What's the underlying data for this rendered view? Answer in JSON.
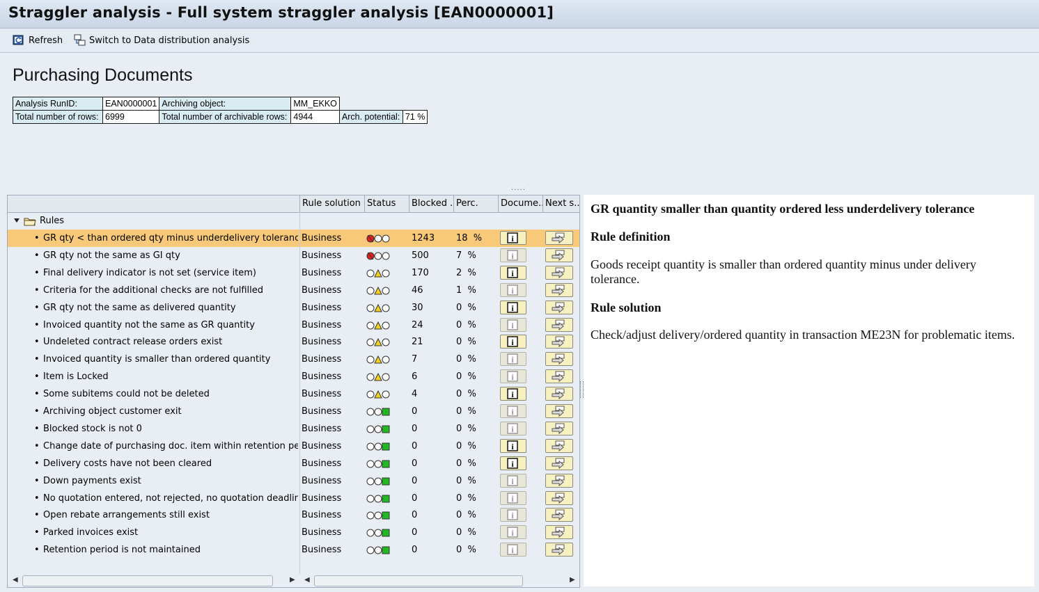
{
  "window": {
    "title": "Straggler analysis - Full system straggler analysis [EAN0000001]"
  },
  "toolbar": {
    "refresh_label": "Refresh",
    "switch_label": "Switch to Data distribution analysis"
  },
  "page": {
    "heading": "Purchasing Documents"
  },
  "info": {
    "run_id_label": "Analysis RunID:",
    "run_id": "EAN0000001",
    "arch_obj_label": "Archiving object:",
    "arch_obj": "MM_EKKO",
    "total_rows_label": "Total number of rows:",
    "total_rows": "6999",
    "archivable_label": "Total number of archivable rows:",
    "archivable": "4944",
    "potential_label": "Arch. potential:",
    "potential": "71 %"
  },
  "grid": {
    "columns": [
      "Rule solution",
      "Status",
      "Blocked ...",
      "Perc.",
      "Docume...",
      "Next s..."
    ],
    "root_label": "Rules",
    "rows": [
      {
        "rule": "GR qty < than ordered qty minus underdelivery tolerance",
        "solution": "Business",
        "status": "red",
        "blocked": "1243",
        "perc": "18  %",
        "doc_enabled": true
      },
      {
        "rule": "GR qty not the same as GI qty",
        "solution": "Business",
        "status": "red",
        "blocked": "500",
        "perc": "7  %",
        "doc_enabled": false
      },
      {
        "rule": "Final delivery indicator is not set (service item)",
        "solution": "Business",
        "status": "yellow",
        "blocked": "170",
        "perc": "2  %",
        "doc_enabled": true
      },
      {
        "rule": "Criteria for the additional checks are not fulfilled",
        "solution": "Business",
        "status": "yellow",
        "blocked": "46",
        "perc": "1  %",
        "doc_enabled": false
      },
      {
        "rule": "GR qty not the same as delivered quantity",
        "solution": "Business",
        "status": "yellow",
        "blocked": "30",
        "perc": "0  %",
        "doc_enabled": true
      },
      {
        "rule": "Invoiced quantity not the same as GR quantity",
        "solution": "Business",
        "status": "yellow",
        "blocked": "24",
        "perc": "0  %",
        "doc_enabled": false
      },
      {
        "rule": "Undeleted contract release orders exist",
        "solution": "Business",
        "status": "yellow",
        "blocked": "21",
        "perc": "0  %",
        "doc_enabled": true
      },
      {
        "rule": "Invoiced quantity is smaller than ordered quantity",
        "solution": "Business",
        "status": "yellow",
        "blocked": "7",
        "perc": "0  %",
        "doc_enabled": false
      },
      {
        "rule": "Item is Locked",
        "solution": "Business",
        "status": "yellow",
        "blocked": "6",
        "perc": "0  %",
        "doc_enabled": false
      },
      {
        "rule": "Some subitems could not be deleted",
        "solution": "Business",
        "status": "yellow",
        "blocked": "4",
        "perc": "0  %",
        "doc_enabled": true
      },
      {
        "rule": "Archiving object customer exit",
        "solution": "Business",
        "status": "green",
        "blocked": "0",
        "perc": "0  %",
        "doc_enabled": false
      },
      {
        "rule": "Blocked stock is not 0",
        "solution": "Business",
        "status": "green",
        "blocked": "0",
        "perc": "0  %",
        "doc_enabled": false
      },
      {
        "rule": "Change date of purchasing doc. item within retention period",
        "solution": "Business",
        "status": "green",
        "blocked": "0",
        "perc": "0  %",
        "doc_enabled": true
      },
      {
        "rule": "Delivery costs have not been cleared",
        "solution": "Business",
        "status": "green",
        "blocked": "0",
        "perc": "0  %",
        "doc_enabled": true
      },
      {
        "rule": "Down payments exist",
        "solution": "Business",
        "status": "green",
        "blocked": "0",
        "perc": "0  %",
        "doc_enabled": false
      },
      {
        "rule": "No quotation entered, not rejected, no quotation deadline",
        "solution": "Business",
        "status": "green",
        "blocked": "0",
        "perc": "0  %",
        "doc_enabled": false
      },
      {
        "rule": "Open rebate arrangements still exist",
        "solution": "Business",
        "status": "green",
        "blocked": "0",
        "perc": "0  %",
        "doc_enabled": false
      },
      {
        "rule": "Parked invoices exist",
        "solution": "Business",
        "status": "green",
        "blocked": "0",
        "perc": "0  %",
        "doc_enabled": false
      },
      {
        "rule": "Retention period is not maintained",
        "solution": "Business",
        "status": "green",
        "blocked": "0",
        "perc": "0  %",
        "doc_enabled": false
      }
    ]
  },
  "detail": {
    "title": "GR quantity smaller than quantity ordered less underdelivery tolerance",
    "definition_heading": "Rule definition",
    "definition_text": "Goods receipt quantity is smaller than ordered quantity minus under delivery tolerance.",
    "solution_heading": "Rule solution",
    "solution_text": "Check/adjust delivery/ordered quantity in transaction ME23N for problematic items."
  }
}
